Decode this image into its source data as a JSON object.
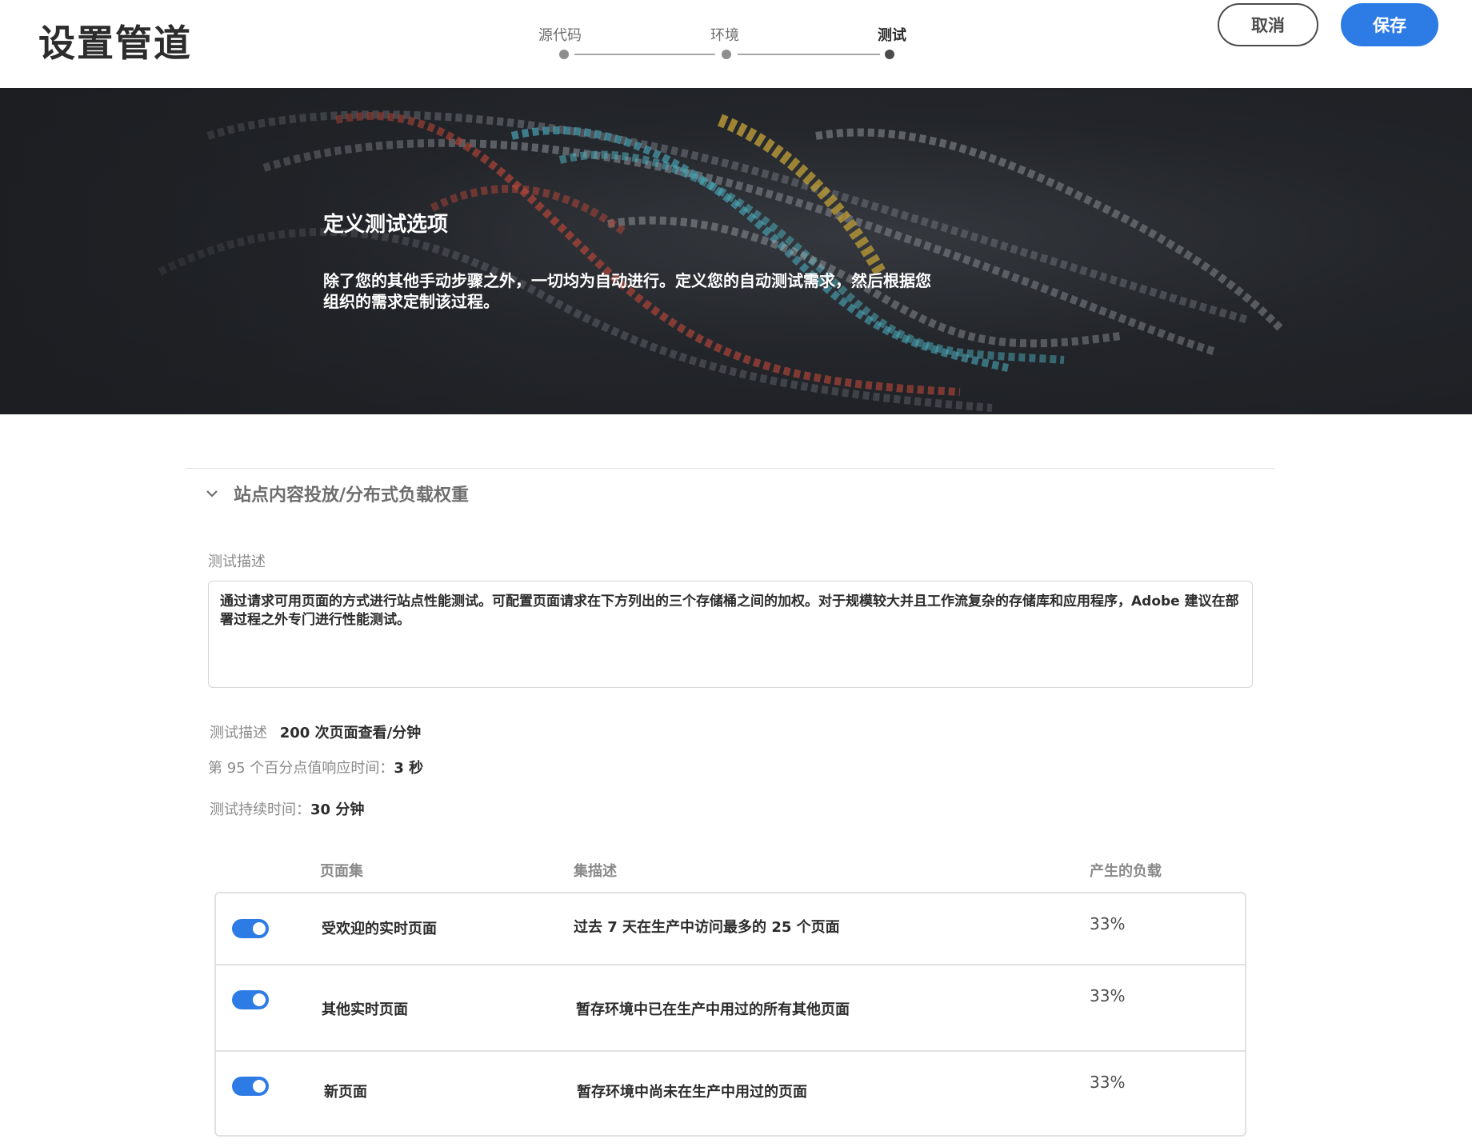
{
  "header": {
    "title": "设置管道",
    "steps": [
      {
        "label": "源代码"
      },
      {
        "label": "环境"
      },
      {
        "label": "测试"
      }
    ],
    "active_step": 3,
    "cancel_label": "取消",
    "save_label": "保存"
  },
  "hero": {
    "title": "定义测试选项",
    "description": "除了您的其他手动步骤之外，一切均为自动进行。定义您的自动测试需求，然后根据您组织的需求定制该过程。"
  },
  "section": {
    "title": "站点内容投放/分布式负载权重",
    "description_label": "测试描述",
    "description_text": "通过请求可用页面的方式进行站点性能测试。可配置页面请求在下方列出的三个存储桶之间的加权。对于规模较大并且工作流复杂的存储库和应用程序，Adobe 建议在部署过程之外专门进行性能测试。",
    "info": [
      {
        "label": "测试描述",
        "value": "200 次页面查看/分钟"
      },
      {
        "label": "第 95 个百分点值响应时间：",
        "value": "3 秒"
      },
      {
        "label": "测试持续时间：",
        "value": "30 分钟"
      }
    ]
  },
  "table": {
    "headers": {
      "page_set": "页面集",
      "set_description": "集描述",
      "load": "产生的负载"
    },
    "rows": [
      {
        "page_set": "受欢迎的实时页面",
        "description": "过去 7 天在生产中访问最多的 25 个页面",
        "load": "33%",
        "enabled": true
      },
      {
        "page_set": "其他实时页面",
        "description": "暂存环境中已在生产中用过的所有其他页面",
        "load": "33%",
        "enabled": true
      },
      {
        "page_set": "新页面",
        "description": "暂存环境中尚未在生产中用过的页面",
        "load": "33%",
        "enabled": true
      }
    ]
  },
  "colors": {
    "accent": "#2d7be5",
    "hero_bg": "#24272c"
  }
}
